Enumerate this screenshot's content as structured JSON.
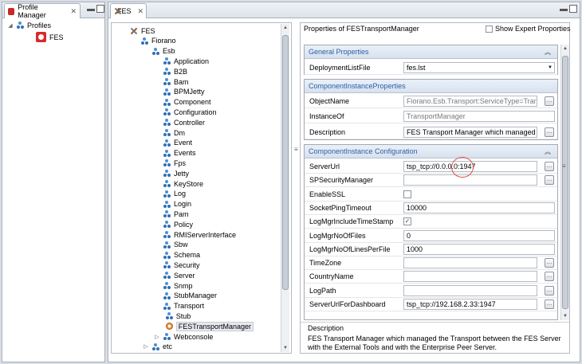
{
  "left_view": {
    "tab_label": "Profile Manager",
    "tree": [
      {
        "label": "Profiles",
        "icon": "folder-icon"
      },
      {
        "label": "FES",
        "icon": "profile-icon"
      }
    ]
  },
  "editor": {
    "tab_label": "FES",
    "tree": [
      {
        "label": "FES",
        "icon": "tools-icon",
        "level": 0
      },
      {
        "label": "Fiorano",
        "icon": "node-icon",
        "level": 1
      },
      {
        "label": "Esb",
        "icon": "node-icon",
        "level": 2
      },
      {
        "label": "Application",
        "icon": "node-icon",
        "level": 3
      },
      {
        "label": "B2B",
        "icon": "node-icon",
        "level": 3
      },
      {
        "label": "Bam",
        "icon": "node-icon",
        "level": 3
      },
      {
        "label": "BPMJetty",
        "icon": "node-icon",
        "level": 3
      },
      {
        "label": "Component",
        "icon": "node-icon",
        "level": 3
      },
      {
        "label": "Configuration",
        "icon": "node-icon",
        "level": 3
      },
      {
        "label": "Controller",
        "icon": "node-icon",
        "level": 3
      },
      {
        "label": "Dm",
        "icon": "node-icon",
        "level": 3
      },
      {
        "label": "Event",
        "icon": "node-icon",
        "level": 3
      },
      {
        "label": "Events",
        "icon": "node-icon",
        "level": 3
      },
      {
        "label": "Fps",
        "icon": "node-icon",
        "level": 3
      },
      {
        "label": "Jetty",
        "icon": "node-icon",
        "level": 3
      },
      {
        "label": "KeyStore",
        "icon": "node-icon",
        "level": 3
      },
      {
        "label": "Log",
        "icon": "node-icon",
        "level": 3
      },
      {
        "label": "Login",
        "icon": "node-icon",
        "level": 3
      },
      {
        "label": "Pam",
        "icon": "node-icon",
        "level": 3
      },
      {
        "label": "Policy",
        "icon": "node-icon",
        "level": 3
      },
      {
        "label": "RMIServerInterface",
        "icon": "node-icon",
        "level": 3
      },
      {
        "label": "Sbw",
        "icon": "node-icon",
        "level": 3
      },
      {
        "label": "Schema",
        "icon": "node-icon",
        "level": 3
      },
      {
        "label": "Security",
        "icon": "node-icon",
        "level": 3
      },
      {
        "label": "Server",
        "icon": "node-icon",
        "level": 3
      },
      {
        "label": "Snmp",
        "icon": "node-icon",
        "level": 3
      },
      {
        "label": "StubManager",
        "icon": "node-icon",
        "level": 3
      },
      {
        "label": "Transport",
        "icon": "node-icon",
        "level": 3
      },
      {
        "label": "Stub",
        "icon": "node-icon",
        "level": 4
      },
      {
        "label": "FESTransportManager",
        "icon": "gear-icon",
        "level": 4,
        "selected": true
      },
      {
        "label": "Webconsole",
        "icon": "node-icon",
        "level": 3,
        "collapsed": true
      },
      {
        "label": "etc",
        "icon": "node-icon",
        "level": 2,
        "collapsed": true
      }
    ],
    "properties_title": "Properties of FESTransportManager",
    "show_expert_label": "Show Expert Proporties",
    "sections": {
      "general": {
        "title": "General Properties",
        "rows": [
          {
            "label": "DeploymentListFile",
            "value": "fes.lst"
          }
        ]
      },
      "instance": {
        "title": "ComponentInstanceProperties",
        "rows": [
          {
            "label": "ObjectName",
            "value": "Fiorano.Esb.Transport:ServiceType=TransportM"
          },
          {
            "label": "InstanceOf",
            "value": "TransportManager"
          },
          {
            "label": "Description",
            "value": "FES Transport Manager which managed the Tr"
          }
        ]
      },
      "config": {
        "title": "ComponentInstance Configuration",
        "rows": [
          {
            "label": "ServerUrl",
            "value": "tsp_tcp://0.0.0.0:1947"
          },
          {
            "label": "SPSecurityManager",
            "value": ""
          },
          {
            "label": "EnableSSL",
            "value": ""
          },
          {
            "label": "SocketPingTimeout",
            "value": "10000"
          },
          {
            "label": "LogMgrIncludeTimeStamp",
            "value": "✓"
          },
          {
            "label": "LogMgrNoOfFiles",
            "value": "0"
          },
          {
            "label": "LogMgrNoOfLinesPerFile",
            "value": "1000"
          },
          {
            "label": "TimeZone",
            "value": ""
          },
          {
            "label": "CountryName",
            "value": ""
          },
          {
            "label": "LogPath",
            "value": ""
          },
          {
            "label": "ServerUrlForDashboard",
            "value": "tsp_tcp://192.168.2.33:1947"
          }
        ]
      }
    },
    "description": {
      "title": "Description",
      "text": "FES Transport Manager which managed the Transport between the FES Server with the External Tools and with the Enterprise Peer Server."
    }
  },
  "colors": {
    "accent": "#2b5fa6",
    "highlight_circle": "#d9534f"
  }
}
